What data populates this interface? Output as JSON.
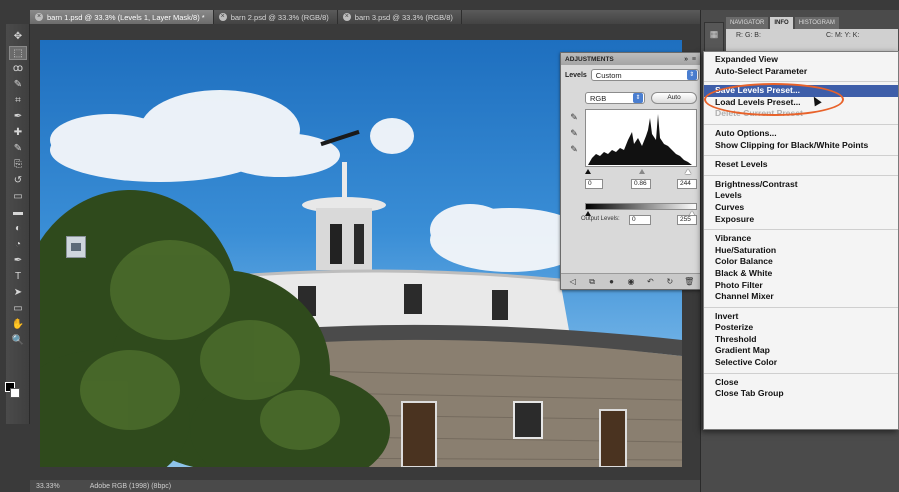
{
  "tabs": [
    {
      "label": "barn 1.psd @ 33.3% (Levels 1, Layer Mask/8) *",
      "active": true
    },
    {
      "label": "barn 2.psd @ 33.3% (RGB/8)",
      "active": false
    },
    {
      "label": "barn 3.psd @ 33.3% (RGB/8)",
      "active": false
    }
  ],
  "tools": [
    "move-tool-icon",
    "marquee-tool-icon",
    "lasso-tool-icon",
    "quick-select-tool-icon",
    "crop-tool-icon",
    "eyedropper-tool-icon",
    "healing-brush-tool-icon",
    "brush-tool-icon",
    "clone-stamp-tool-icon",
    "history-brush-tool-icon",
    "eraser-tool-icon",
    "gradient-tool-icon",
    "blur-tool-icon",
    "dodge-tool-icon",
    "pen-tool-icon",
    "type-tool-icon",
    "path-select-tool-icon",
    "shape-tool-icon",
    "3d-rotate-tool-icon",
    "3d-orbit-tool-icon",
    "hand-tool-icon",
    "zoom-tool-icon"
  ],
  "adjustments": {
    "title": "ADJUSTMENTS",
    "panel_controls": "»  ≡",
    "preset_label": "Levels",
    "preset_value": "Custom",
    "channel": "RGB",
    "auto_label": "Auto",
    "input_black": "0",
    "input_gamma": "0.86",
    "input_white": "244",
    "output_label": "Output Levels:",
    "output_black": "0",
    "output_white": "255"
  },
  "right_panel": {
    "tabs": [
      "NAVIGATOR",
      "INFO",
      "HISTOGRAM"
    ],
    "active_tab": "INFO",
    "info_left": "R: G: B:",
    "info_right": "C: M: Y: K:"
  },
  "menu": {
    "items": [
      {
        "label": "Expanded View",
        "state": "normal"
      },
      {
        "label": "Auto-Select Parameter",
        "state": "normal"
      },
      {
        "sep": true
      },
      {
        "label": "Save Levels Preset...",
        "state": "highlighted"
      },
      {
        "label": "Load Levels Preset...",
        "state": "normal"
      },
      {
        "label": "Delete Current Preset",
        "state": "disabled"
      },
      {
        "sep": true
      },
      {
        "label": "Auto Options...",
        "state": "normal"
      },
      {
        "label": "Show Clipping for Black/White Points",
        "state": "normal"
      },
      {
        "sep": true
      },
      {
        "label": "Reset Levels",
        "state": "normal"
      },
      {
        "sep": true
      },
      {
        "label": "Brightness/Contrast",
        "state": "normal"
      },
      {
        "label": "Levels",
        "state": "normal"
      },
      {
        "label": "Curves",
        "state": "normal"
      },
      {
        "label": "Exposure",
        "state": "normal"
      },
      {
        "sep": true
      },
      {
        "label": "Vibrance",
        "state": "normal"
      },
      {
        "label": "Hue/Saturation",
        "state": "normal"
      },
      {
        "label": "Color Balance",
        "state": "normal"
      },
      {
        "label": "Black & White",
        "state": "normal"
      },
      {
        "label": "Photo Filter",
        "state": "normal"
      },
      {
        "label": "Channel Mixer",
        "state": "normal"
      },
      {
        "sep": true
      },
      {
        "label": "Invert",
        "state": "normal"
      },
      {
        "label": "Posterize",
        "state": "normal"
      },
      {
        "label": "Threshold",
        "state": "normal"
      },
      {
        "label": "Gradient Map",
        "state": "normal"
      },
      {
        "label": "Selective Color",
        "state": "normal"
      },
      {
        "sep": true
      },
      {
        "label": "Close",
        "state": "normal"
      },
      {
        "label": "Close Tab Group",
        "state": "normal"
      }
    ]
  },
  "status": {
    "zoom": "33.33%",
    "doc": "Adobe RGB (1998) (8bpc)"
  },
  "colors": {
    "menu_highlight": "#3e5ea9",
    "annotation_circle": "#e8622a"
  }
}
